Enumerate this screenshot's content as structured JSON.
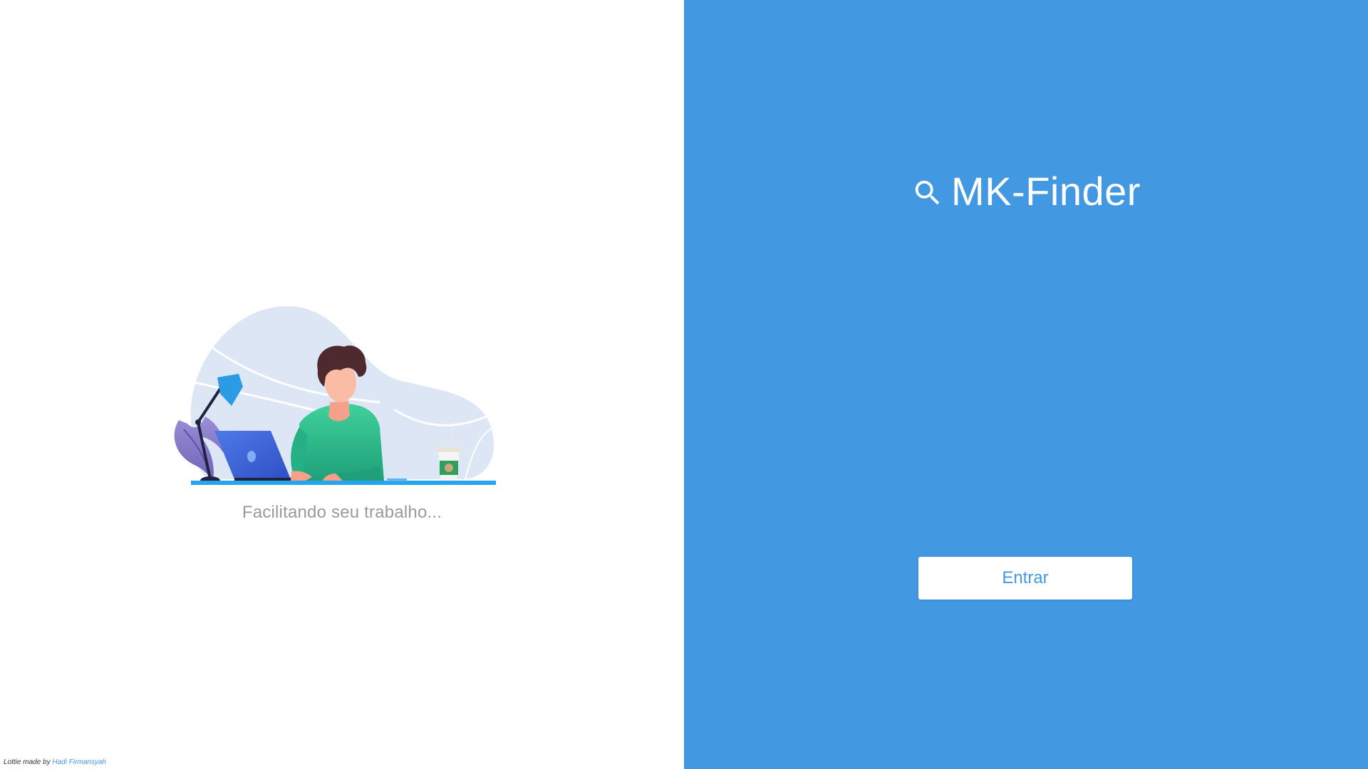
{
  "left_panel": {
    "tagline": "Facilitando seu trabalho...",
    "credit": {
      "prefix": "Lottie made by",
      "author": "Hadi Firmansyah"
    },
    "illustration": "person-working-at-laptop-illustration"
  },
  "right_panel": {
    "brand": {
      "icon": "search-icon",
      "title": "MK-Finder"
    },
    "login_button_label": "Entrar"
  },
  "colors": {
    "primary": "#4398e2",
    "tagline_text": "#9a9a9a",
    "background_left": "#ffffff"
  }
}
